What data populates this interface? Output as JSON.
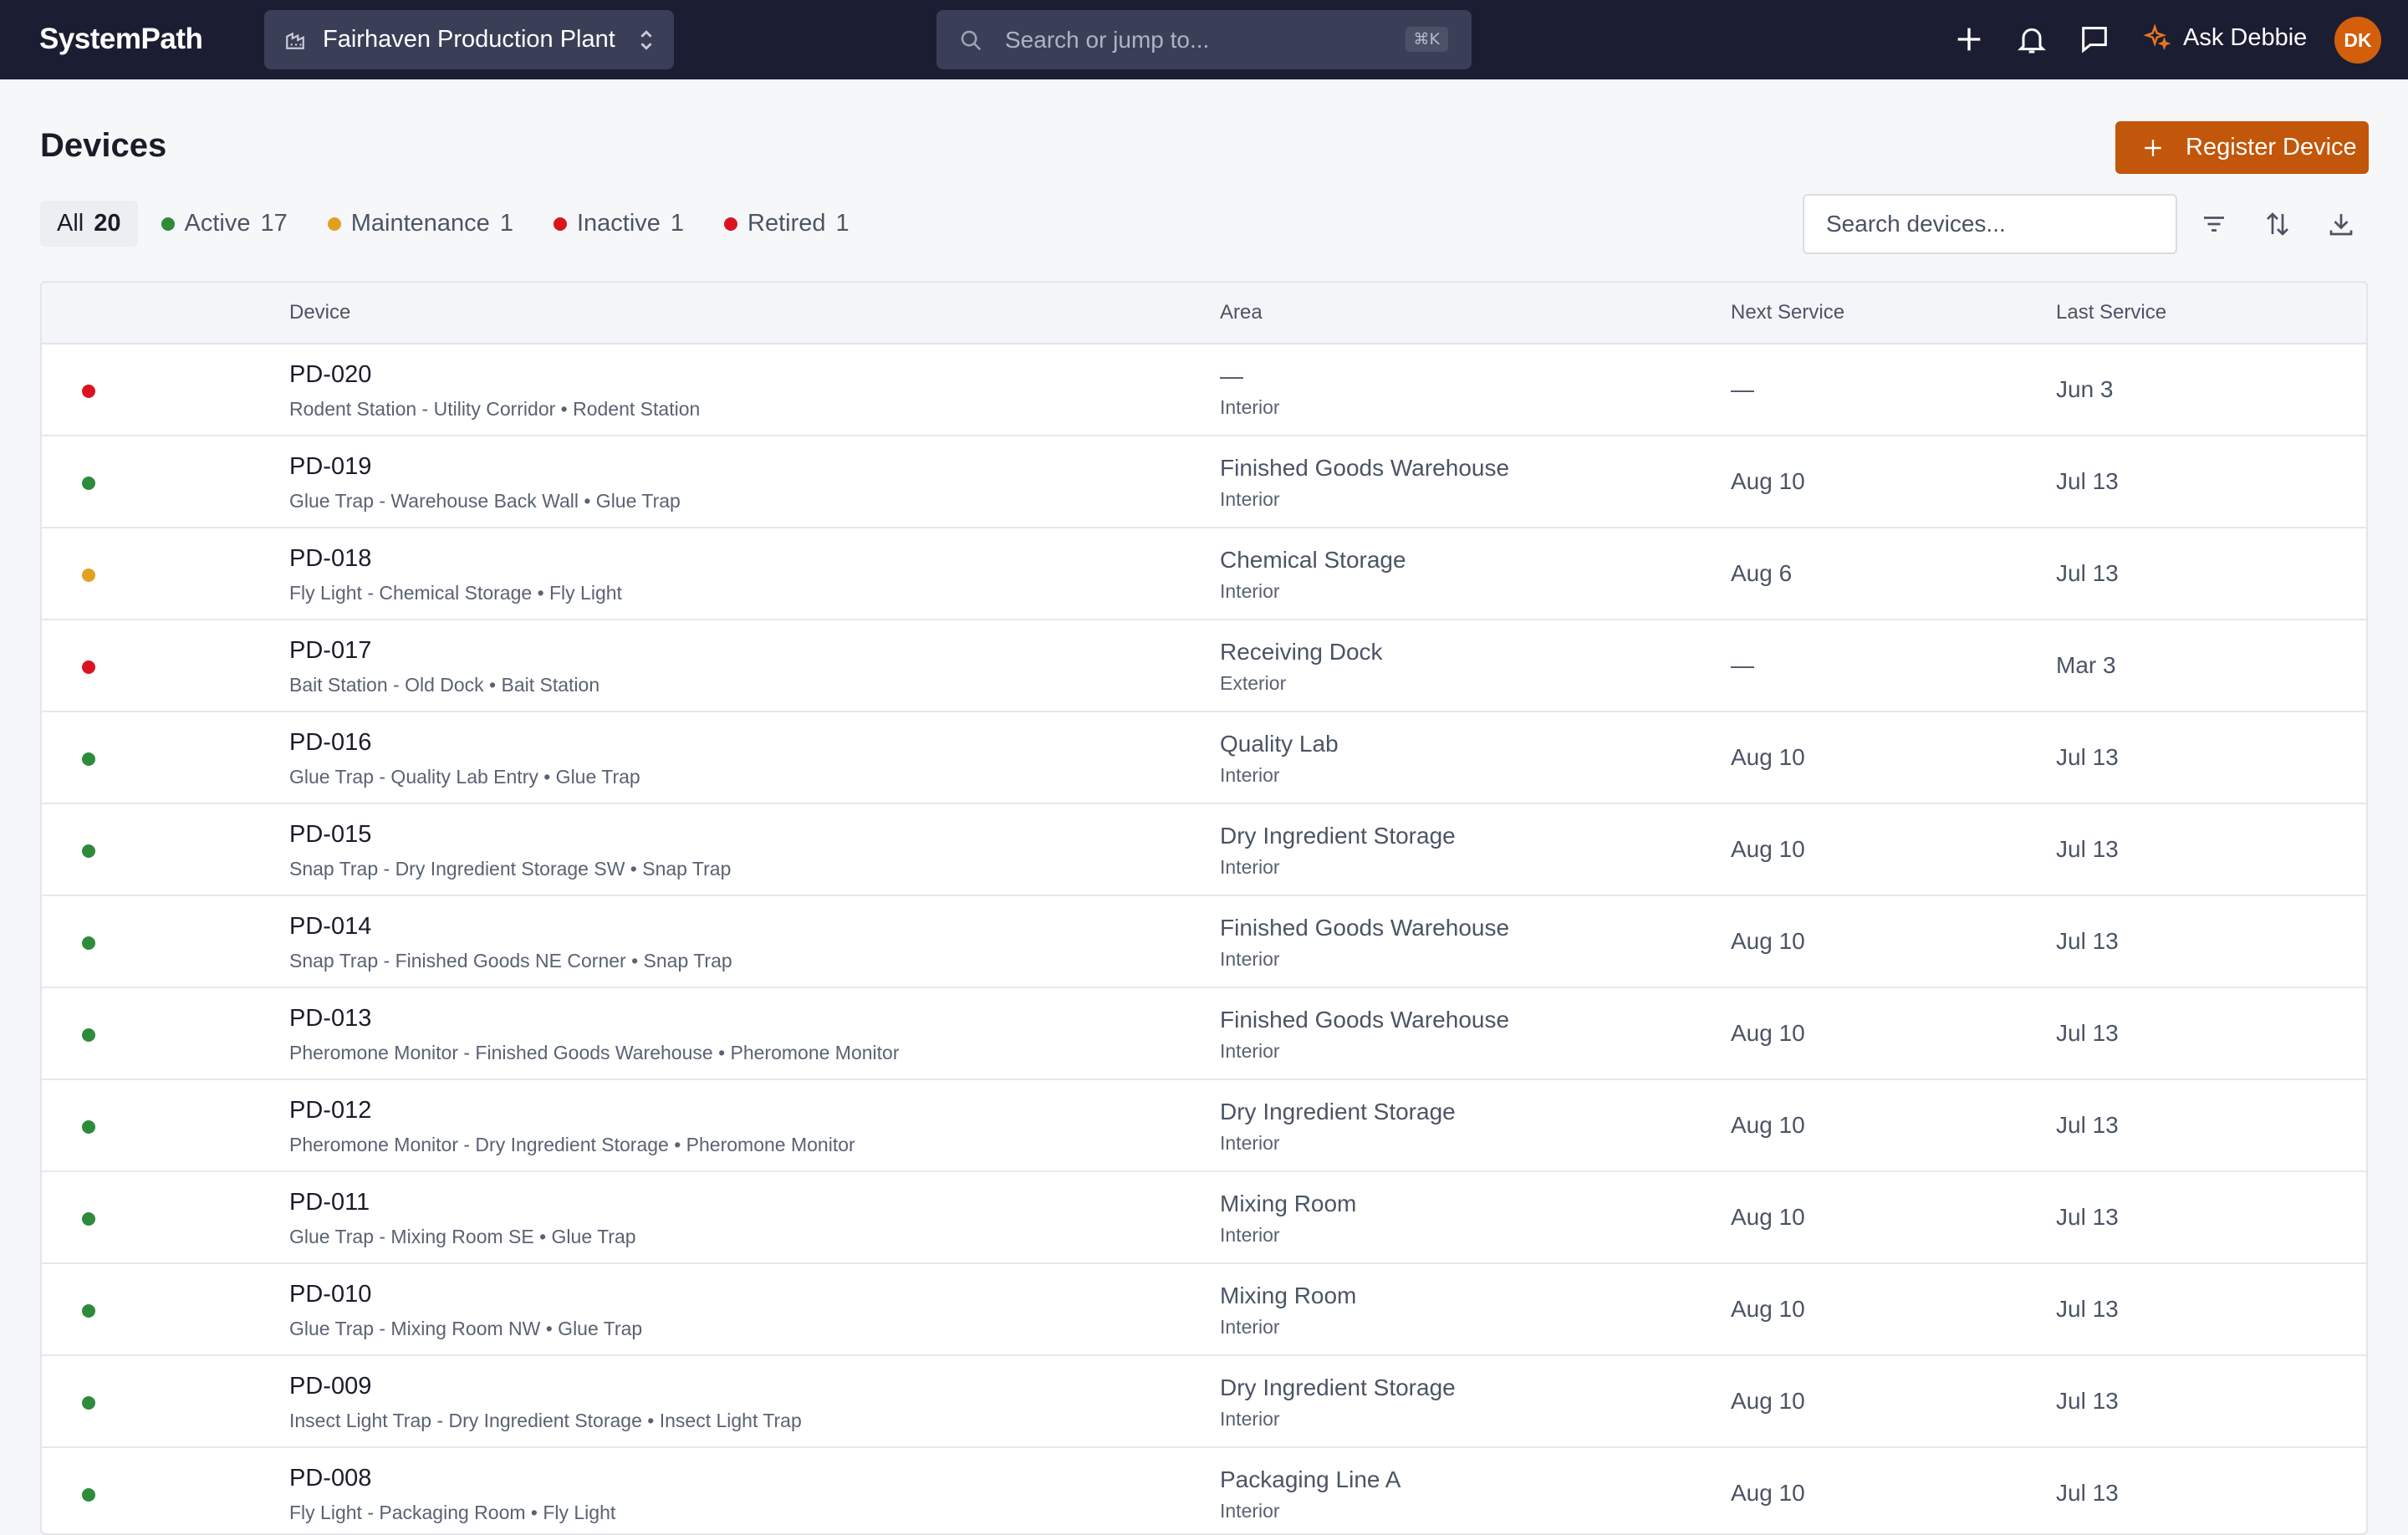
{
  "app": {
    "brand": "SystemPath",
    "site": "Fairhaven Production Plant",
    "search_placeholder": "Search or jump to...",
    "search_shortcut": "⌘K",
    "assistant_label": "Ask Debbie",
    "avatar_initials": "DK"
  },
  "page": {
    "title": "Devices",
    "register_label": "Register Device",
    "device_search_placeholder": "Search devices..."
  },
  "colors": {
    "accent": "#c2560a",
    "active": "#2e8b3a",
    "maintenance": "#e3a020",
    "inactive": "#d9141e",
    "retired": "#d9141e"
  },
  "filters": [
    {
      "label": "All",
      "count": "20",
      "selected": true,
      "status": ""
    },
    {
      "label": "Active",
      "count": "17",
      "selected": false,
      "status": "active"
    },
    {
      "label": "Maintenance",
      "count": "1",
      "selected": false,
      "status": "maintenance"
    },
    {
      "label": "Inactive",
      "count": "1",
      "selected": false,
      "status": "inactive"
    },
    {
      "label": "Retired",
      "count": "1",
      "selected": false,
      "status": "retired"
    }
  ],
  "table": {
    "columns": {
      "device": "Device",
      "area": "Area",
      "next_service": "Next Service",
      "last_service": "Last Service"
    },
    "rows": [
      {
        "status": "inactive",
        "id": "PD-020",
        "description": "Rodent Station - Utility Corridor • Rodent Station",
        "area": "—",
        "area_type": "Interior",
        "next_service": "—",
        "last_service": "Jun 3"
      },
      {
        "status": "active",
        "id": "PD-019",
        "description": "Glue Trap - Warehouse Back Wall • Glue Trap",
        "area": "Finished Goods Warehouse",
        "area_type": "Interior",
        "next_service": "Aug 10",
        "last_service": "Jul 13"
      },
      {
        "status": "maintenance",
        "id": "PD-018",
        "description": "Fly Light - Chemical Storage • Fly Light",
        "area": "Chemical Storage",
        "area_type": "Interior",
        "next_service": "Aug 6",
        "last_service": "Jul 13"
      },
      {
        "status": "inactive",
        "id": "PD-017",
        "description": "Bait Station - Old Dock • Bait Station",
        "area": "Receiving Dock",
        "area_type": "Exterior",
        "next_service": "—",
        "last_service": "Mar 3"
      },
      {
        "status": "active",
        "id": "PD-016",
        "description": "Glue Trap - Quality Lab Entry • Glue Trap",
        "area": "Quality Lab",
        "area_type": "Interior",
        "next_service": "Aug 10",
        "last_service": "Jul 13"
      },
      {
        "status": "active",
        "id": "PD-015",
        "description": "Snap Trap - Dry Ingredient Storage SW • Snap Trap",
        "area": "Dry Ingredient Storage",
        "area_type": "Interior",
        "next_service": "Aug 10",
        "last_service": "Jul 13"
      },
      {
        "status": "active",
        "id": "PD-014",
        "description": "Snap Trap - Finished Goods NE Corner • Snap Trap",
        "area": "Finished Goods Warehouse",
        "area_type": "Interior",
        "next_service": "Aug 10",
        "last_service": "Jul 13"
      },
      {
        "status": "active",
        "id": "PD-013",
        "description": "Pheromone Monitor - Finished Goods Warehouse • Pheromone Monitor",
        "area": "Finished Goods Warehouse",
        "area_type": "Interior",
        "next_service": "Aug 10",
        "last_service": "Jul 13"
      },
      {
        "status": "active",
        "id": "PD-012",
        "description": "Pheromone Monitor - Dry Ingredient Storage • Pheromone Monitor",
        "area": "Dry Ingredient Storage",
        "area_type": "Interior",
        "next_service": "Aug 10",
        "last_service": "Jul 13"
      },
      {
        "status": "active",
        "id": "PD-011",
        "description": "Glue Trap - Mixing Room SE • Glue Trap",
        "area": "Mixing Room",
        "area_type": "Interior",
        "next_service": "Aug 10",
        "last_service": "Jul 13"
      },
      {
        "status": "active",
        "id": "PD-010",
        "description": "Glue Trap - Mixing Room NW • Glue Trap",
        "area": "Mixing Room",
        "area_type": "Interior",
        "next_service": "Aug 10",
        "last_service": "Jul 13"
      },
      {
        "status": "active",
        "id": "PD-009",
        "description": "Insect Light Trap - Dry Ingredient Storage • Insect Light Trap",
        "area": "Dry Ingredient Storage",
        "area_type": "Interior",
        "next_service": "Aug 10",
        "last_service": "Jul 13"
      },
      {
        "status": "active",
        "id": "PD-008",
        "description": "Fly Light - Packaging Room • Fly Light",
        "area": "Packaging Line A",
        "area_type": "Interior",
        "next_service": "Aug 10",
        "last_service": "Jul 13"
      }
    ]
  }
}
